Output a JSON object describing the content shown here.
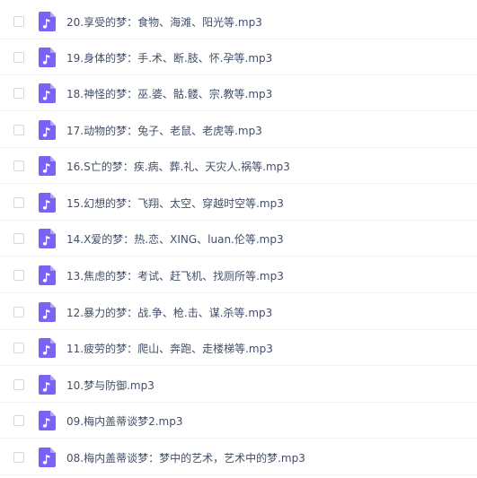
{
  "file_list": {
    "icon": "music-file-icon",
    "icon_color": "#7b61f5",
    "items": [
      {
        "name": "20.享受的梦：食物、海滩、阳光等.mp3"
      },
      {
        "name": "19.身体的梦：手.术、断.肢、怀.孕等.mp3"
      },
      {
        "name": "18.神怪的梦：巫.婆、骷.髅、宗.教等.mp3"
      },
      {
        "name": "17.动物的梦：兔子、老鼠、老虎等.mp3"
      },
      {
        "name": "16.S亡的梦：疾.病、葬.礼、天灾人.祸等.mp3"
      },
      {
        "name": "15.幻想的梦：飞翔、太空、穿越时空等.mp3"
      },
      {
        "name": "14.X爱的梦：热.恋、XING、luan.伦等.mp3"
      },
      {
        "name": "13.焦虑的梦：考试、赶飞机、找厕所等.mp3"
      },
      {
        "name": "12.暴力的梦：战.争、枪.击、谋.杀等.mp3"
      },
      {
        "name": "11.疲劳的梦：爬山、奔跑、走楼梯等.mp3"
      },
      {
        "name": "10.梦与防御.mp3"
      },
      {
        "name": "09.梅内盖蒂谈梦2.mp3"
      },
      {
        "name": "08.梅内盖蒂谈梦：梦中的艺术，艺术中的梦.mp3"
      }
    ]
  }
}
